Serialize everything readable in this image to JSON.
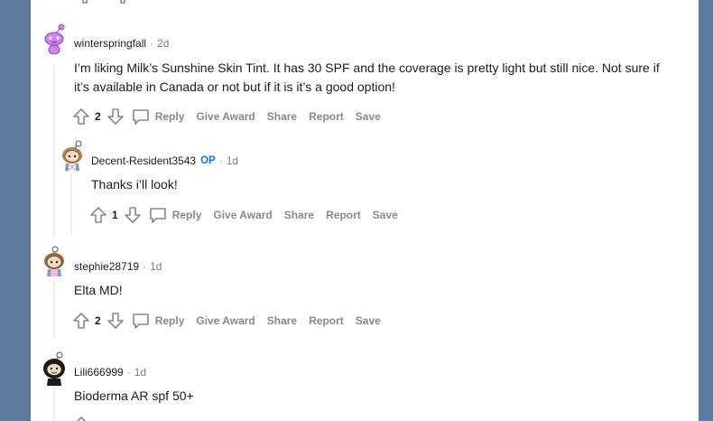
{
  "comments": [
    {
      "author": "winterspringfall",
      "op": "",
      "time": "2d",
      "body": "I’m liking Milk’s Sunshine Skin Tint. It has 30 SPF and the coverage is pretty light but still nice. Not sure if it’s available in Canada or not but if it is it’s a good option!",
      "score": "2",
      "avatar": "purple-snoo",
      "actions": [
        "Reply",
        "Give Award",
        "Share",
        "Report",
        "Save"
      ]
    },
    {
      "author": "Decent-Resident3543",
      "op": "OP",
      "time": "1d",
      "body": "Thanks i’ll look!",
      "score": "1",
      "avatar": "snoo-blue-hair",
      "actions": [
        "Reply",
        "Give Award",
        "Share",
        "Report",
        "Save"
      ]
    },
    {
      "author": "stephie28719",
      "op": "",
      "time": "1d",
      "body": "Elta MD!",
      "score": "2",
      "avatar": "snoo-pink-hair",
      "actions": [
        "Reply",
        "Give Award",
        "Share",
        "Report",
        "Save"
      ]
    },
    {
      "author": "Lili666999",
      "op": "",
      "time": "1d",
      "body": "Bioderma AR spf 50+",
      "score": "",
      "avatar": "snoo-black-hair",
      "actions": []
    }
  ],
  "colors": {
    "background": "#5f7aa0",
    "panel": "#ffffff",
    "op_blue": "#0079d3",
    "muted": "#878a8c"
  }
}
